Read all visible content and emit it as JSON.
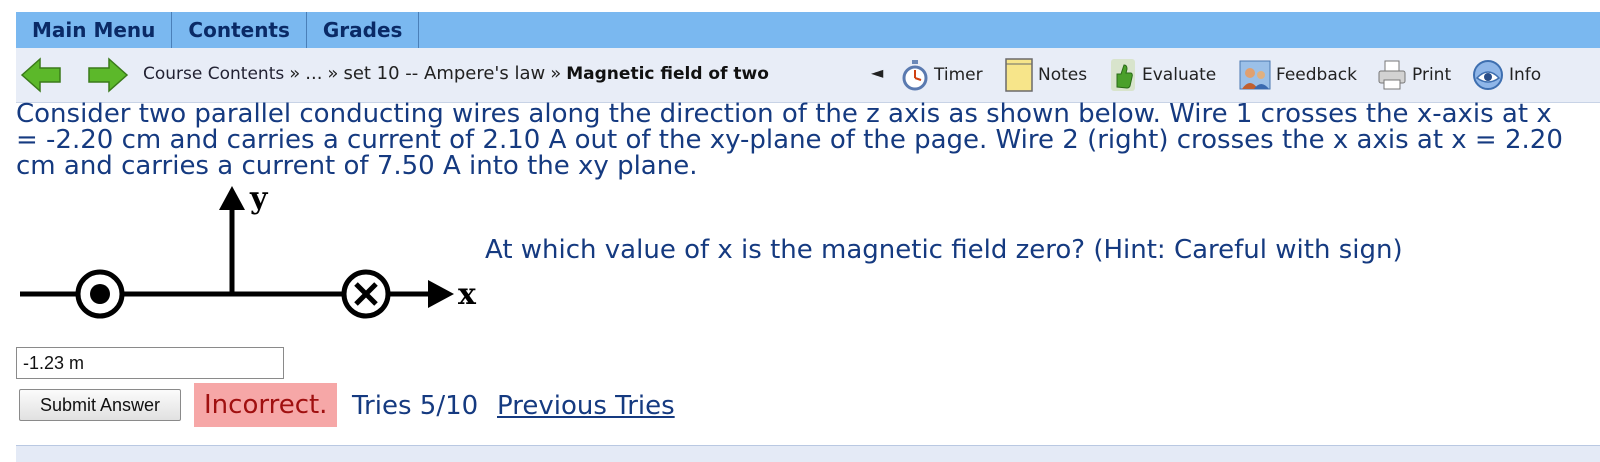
{
  "menu": {
    "items": [
      {
        "label": "Main Menu"
      },
      {
        "label": "Contents"
      },
      {
        "label": "Grades"
      }
    ]
  },
  "navbar": {
    "breadcrumb": {
      "course_contents": "Course Contents",
      "separator": "»",
      "ellipsis": "...",
      "set": "set 10 -- Ampere's law",
      "current": "Magnetic field of two"
    },
    "back_glyph": "◄",
    "tools": [
      {
        "label": "Timer",
        "icon": "stopwatch-icon"
      },
      {
        "label": "Notes",
        "icon": "notepad-icon"
      },
      {
        "label": "Evaluate",
        "icon": "thumb-icon"
      },
      {
        "label": "Feedback",
        "icon": "feedback-icon"
      },
      {
        "label": "Print",
        "icon": "printer-icon"
      },
      {
        "label": "Info",
        "icon": "info-icon"
      }
    ],
    "colors": {
      "arrow_green": "#5cb82a"
    }
  },
  "problem": {
    "text": "Consider two parallel conducting wires along the direction of the z axis as shown below. Wire 1 crosses the x-axis at x = -2.20 cm and carries a current of 2.10 A out of the xy-plane of the page. Wire 2 (right) crosses the x axis at x = 2.20 cm and carries a current of 7.50 A into the xy plane.",
    "diagram": {
      "y_label": "y",
      "x_label": "x"
    },
    "question": "At which value of x is the magnetic field zero? (Hint: Careful with sign)"
  },
  "answer": {
    "value": "-1.23 m",
    "submit_label": "Submit Answer",
    "result": "Incorrect.",
    "tries": "Tries 5/10",
    "previous_tries": "Previous Tries"
  }
}
